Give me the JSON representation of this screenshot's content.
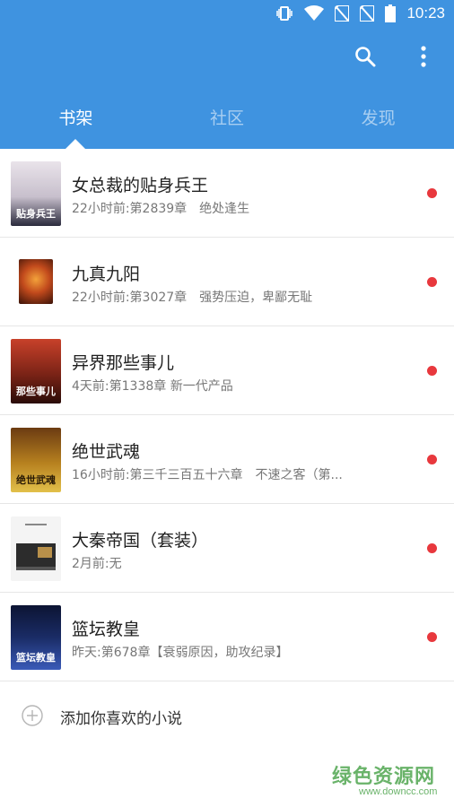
{
  "status_bar": {
    "time": "10:23"
  },
  "tabs": [
    {
      "label": "书架",
      "active": true
    },
    {
      "label": "社区",
      "active": false
    },
    {
      "label": "发现",
      "active": false
    }
  ],
  "books": [
    {
      "title": "女总裁的贴身兵王",
      "subtitle": "22小时前:第2839章　绝处逢生",
      "cover_text": "贴身兵王",
      "cover_color": "#c9c2cf",
      "unread": true
    },
    {
      "title": "九真九阳",
      "subtitle": "22小时前:第3027章　强势压迫，卑鄙无耻",
      "cover_text": "",
      "cover_color": "#c24a1c",
      "unread": true
    },
    {
      "title": "异界那些事儿",
      "subtitle": "4天前:第1338章 新一代产品",
      "cover_text": "那些事儿",
      "cover_color": "#7a2316",
      "unread": true
    },
    {
      "title": "绝世武魂",
      "subtitle": "16小时前:第三千三百五十六章　不速之客（第...",
      "cover_text": "绝世武魂",
      "cover_color": "#b7811f",
      "unread": true
    },
    {
      "title": "大秦帝国（套装）",
      "subtitle": "2月前:无",
      "cover_text": "",
      "cover_color": "#f1f1f1",
      "unread": true
    },
    {
      "title": "篮坛教皇",
      "subtitle": "昨天:第678章【衰弱原因，助攻纪录】",
      "cover_text": "篮坛教皇",
      "cover_color": "#1a2c66",
      "unread": true
    }
  ],
  "add_novel": {
    "label": "添加你喜欢的小说"
  },
  "watermark": {
    "text": "绿色资源网",
    "url": "www.downcc.com"
  },
  "colors": {
    "primary": "#3f93e0",
    "unread_dot": "#e8383d"
  }
}
